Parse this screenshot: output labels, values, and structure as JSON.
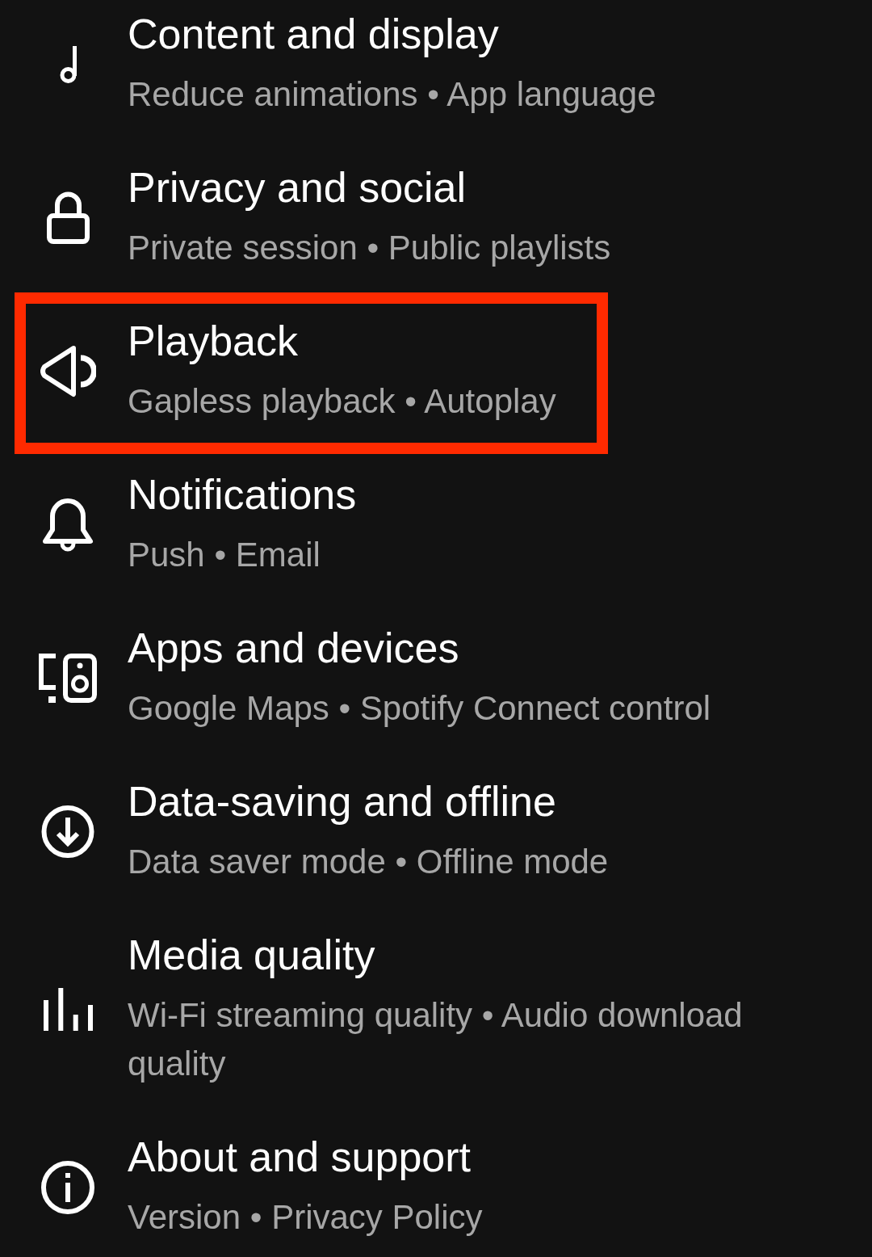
{
  "items": [
    {
      "kind": "note",
      "title": "Content and display",
      "subtitle": "Reduce animations • App language",
      "highlighted": false
    },
    {
      "kind": "lock",
      "title": "Privacy and social",
      "subtitle": "Private session • Public playlists",
      "highlighted": false
    },
    {
      "kind": "speaker",
      "title": "Playback",
      "subtitle": "Gapless playback • Autoplay",
      "highlighted": true
    },
    {
      "kind": "bell",
      "title": "Notifications",
      "subtitle": "Push • Email",
      "highlighted": false
    },
    {
      "kind": "devices",
      "title": "Apps and devices",
      "subtitle": "Google Maps • Spotify Connect control",
      "highlighted": false
    },
    {
      "kind": "download",
      "title": "Data-saving and offline",
      "subtitle": "Data saver mode • Offline mode",
      "highlighted": false
    },
    {
      "kind": "bars",
      "title": "Media quality",
      "subtitle": "Wi-Fi streaming quality • Audio download quality",
      "highlighted": false
    },
    {
      "kind": "info",
      "title": "About and support",
      "subtitle": "Version • Privacy Policy",
      "highlighted": false
    }
  ]
}
